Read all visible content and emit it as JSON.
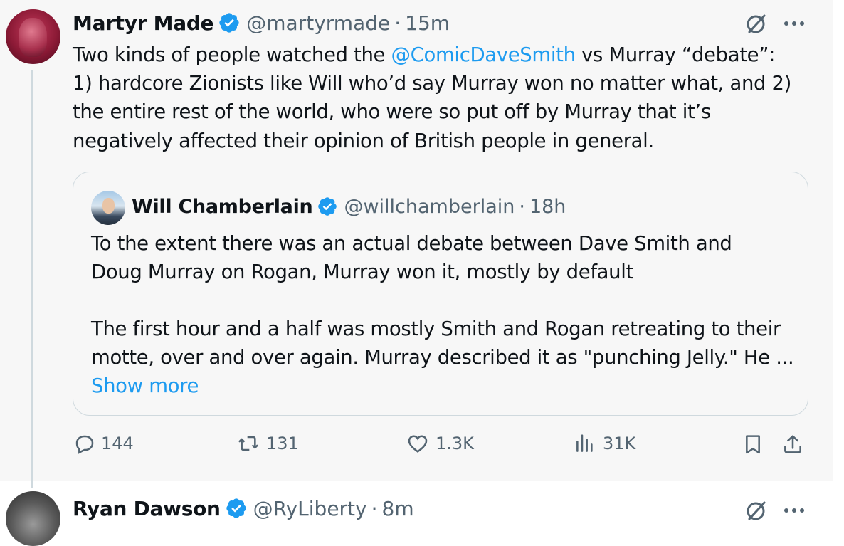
{
  "tweet": {
    "author": {
      "name": "Martyr Made",
      "handle": "@martyrmade",
      "time": "15m"
    },
    "text": {
      "line1_before": "Two kinds of people watched the ",
      "mention": "@ComicDaveSmith",
      "line1_after": " vs Murray “debate”:",
      "line2": "1) hardcore Zionists like Will who’d say Murray won no matter what, and 2)",
      "line3": "the entire rest of the world, who were so put off by Murray that it’s",
      "line4": "negatively affected their opinion of British people in general."
    },
    "quote": {
      "author": {
        "name": "Will Chamberlain",
        "handle": "@willchamberlain",
        "time": "18h"
      },
      "para1_line1": "To the extent there was an actual debate between Dave Smith and",
      "para1_line2": "Doug Murray on Rogan, Murray won it, mostly by default",
      "para2_line1": "The first hour and a half was mostly Smith and Rogan retreating to their",
      "para2_line2": "motte, over and over again. Murray described it as \"punching Jelly.\" He ...",
      "show_more": "Show more"
    },
    "actions": {
      "replies": "144",
      "reposts": "131",
      "likes": "1.3K",
      "views": "31K"
    }
  },
  "next_tweet": {
    "author": {
      "name": "Ryan Dawson",
      "handle": "@RyLiberty",
      "time": "8m"
    }
  },
  "colors": {
    "accent": "#1d9bf0",
    "muted": "#536471",
    "text": "#0f1419",
    "border": "#cfd9de",
    "background": "#f7f7f7"
  },
  "icons": [
    "verified-badge-icon",
    "grok-icon",
    "more-icon",
    "reply-icon",
    "repost-icon",
    "like-icon",
    "views-icon",
    "bookmark-icon",
    "share-icon"
  ]
}
